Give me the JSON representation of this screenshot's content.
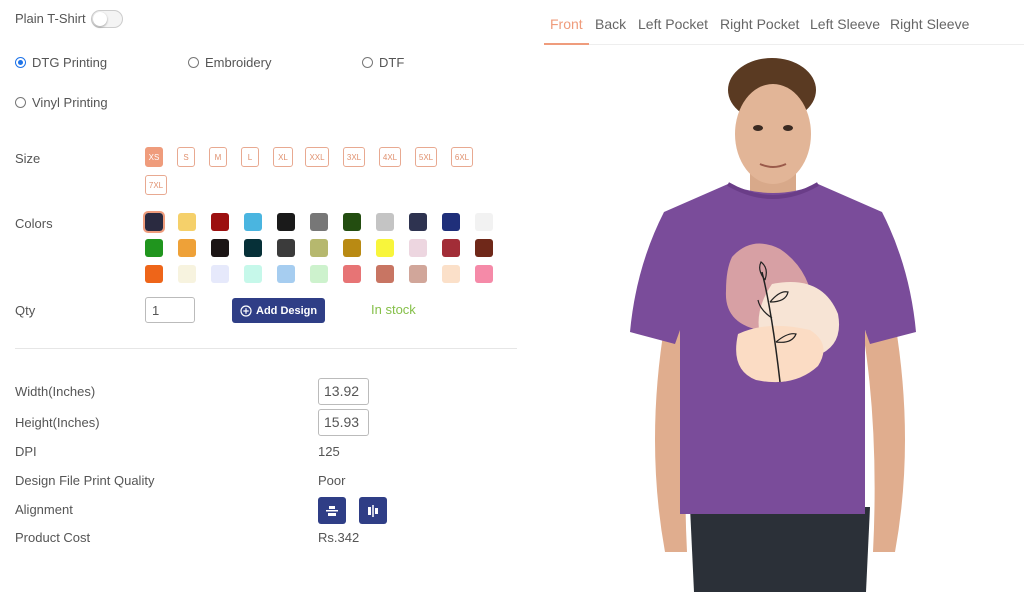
{
  "product": {
    "plain_tshirt_label": "Plain T-Shirt"
  },
  "print_methods": [
    {
      "label": "DTG Printing",
      "selected": true
    },
    {
      "label": "Embroidery",
      "selected": false
    },
    {
      "label": "DTF",
      "selected": false
    },
    {
      "label": "Vinyl Printing",
      "selected": false
    }
  ],
  "size": {
    "label": "Size",
    "options": [
      "XS",
      "S",
      "M",
      "L",
      "XL",
      "XXL",
      "3XL",
      "4XL",
      "5XL",
      "6XL",
      "7XL"
    ],
    "selected": "XS"
  },
  "colors": {
    "label": "Colors",
    "swatches": [
      "#2a2a40",
      "#f5d06a",
      "#9c1010",
      "#4ab5e0",
      "#1a1a1a",
      "#777777",
      "#234d10",
      "#c4c4c4",
      "#2e3350",
      "#1f2f7a",
      "#f2f2f2",
      "#20951e",
      "#eea138",
      "#1c1515",
      "#063038",
      "#3b3b3b",
      "#b6b86e",
      "#b98a13",
      "#f8f53b",
      "#edd6e0",
      "#a22d37",
      "#6f2819",
      "#ee6519",
      "#f7f3df",
      "#e6e9fb",
      "#c6f8ea",
      "#a6cdf0",
      "#cdf2cd",
      "#e77475",
      "#c87563",
      "#d1a69a",
      "#fbe0c9",
      "#f58aa8"
    ],
    "selected_index": 0
  },
  "qty": {
    "label": "Qty",
    "value": "1"
  },
  "add_design_label": "Add Design",
  "stock_status": "In stock",
  "specs": {
    "width_label": "Width(Inches)",
    "width_value": "13.92",
    "height_label": "Height(Inches)",
    "height_value": "15.93",
    "dpi_label": "DPI",
    "dpi_value": "125",
    "quality_label": "Design File Print Quality",
    "quality_value": "Poor",
    "alignment_label": "Alignment",
    "cost_label": "Product Cost",
    "cost_value": "Rs.342"
  },
  "tabs": [
    {
      "label": "Front",
      "active": true
    },
    {
      "label": "Back",
      "active": false
    },
    {
      "label": "Left Pocket",
      "active": false
    },
    {
      "label": "Right Pocket",
      "active": false
    },
    {
      "label": "Left Sleeve",
      "active": false
    },
    {
      "label": "Right Sleeve",
      "active": false
    }
  ],
  "accent_color": "#ef9c7c",
  "button_color": "#2f3e86",
  "tshirt_color": "#7a4c9a"
}
